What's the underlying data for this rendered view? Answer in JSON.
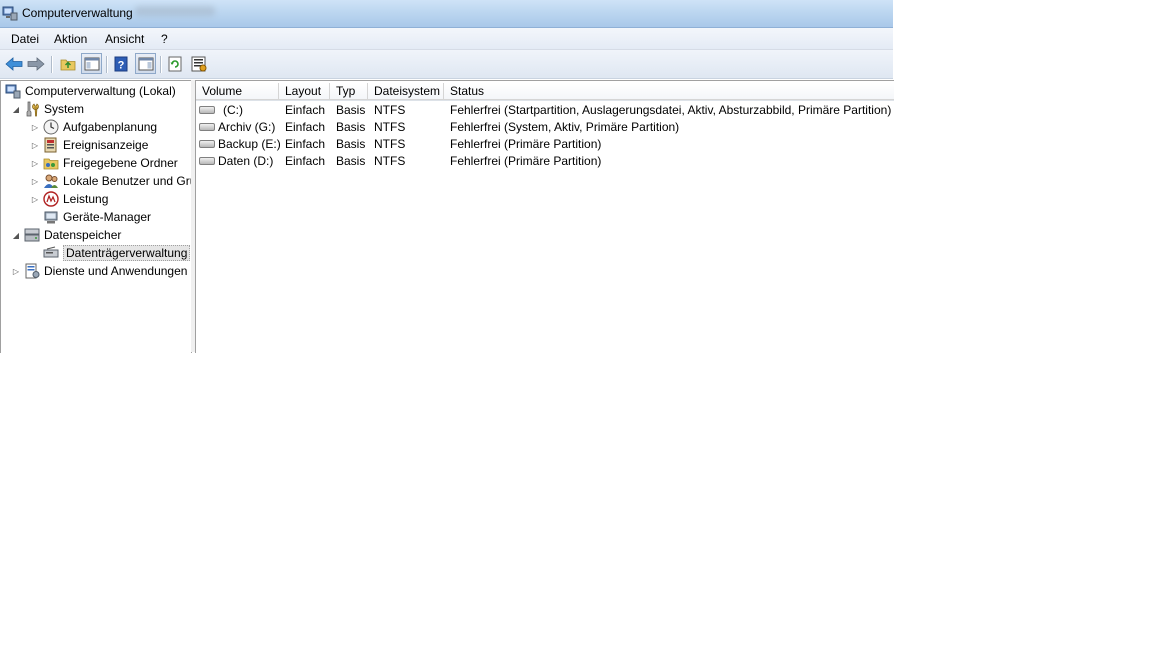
{
  "window": {
    "title": "Computerverwaltung"
  },
  "menu": [
    "Datei",
    "Aktion",
    "Ansicht",
    "?"
  ],
  "toolbar": {
    "buttons": [
      "back-arrow-icon",
      "forward-arrow-icon",
      "up-folder-icon",
      "show-hide-console-tree-icon",
      "help-icon",
      "show-hide-action-pane-icon",
      "refresh-icon",
      "properties-icon"
    ]
  },
  "tree": {
    "root": "Computerverwaltung (Lokal)",
    "system": "System",
    "aufgaben": "Aufgabenplanung",
    "ereignis": "Ereignisanzeige",
    "freigegeben": "Freigegebene Ordner",
    "lokale": "Lokale Benutzer und Gruppen",
    "leistung": "Leistung",
    "geraete": "Geräte-Manager",
    "datenspeicher": "Datenspeicher",
    "datentraeger": "Datenträgerverwaltung",
    "dienste": "Dienste und Anwendungen"
  },
  "table": {
    "columns": [
      "Volume",
      "Layout",
      "Typ",
      "Dateisystem",
      "Status"
    ],
    "rows": [
      {
        "volume": "(C:)",
        "layout": "Einfach",
        "typ": "Basis",
        "fs": "NTFS",
        "status": "Fehlerfrei (Startpartition, Auslagerungsdatei, Aktiv, Absturzabbild, Primäre Partition)"
      },
      {
        "volume": "Archiv (G:)",
        "layout": "Einfach",
        "typ": "Basis",
        "fs": "NTFS",
        "status": "Fehlerfrei (System, Aktiv, Primäre Partition)"
      },
      {
        "volume": "Backup (E:)",
        "layout": "Einfach",
        "typ": "Basis",
        "fs": "NTFS",
        "status": "Fehlerfrei (Primäre Partition)"
      },
      {
        "volume": "Daten (D:)",
        "layout": "Einfach",
        "typ": "Basis",
        "fs": "NTFS",
        "status": "Fehlerfrei (Primäre Partition)"
      }
    ]
  }
}
